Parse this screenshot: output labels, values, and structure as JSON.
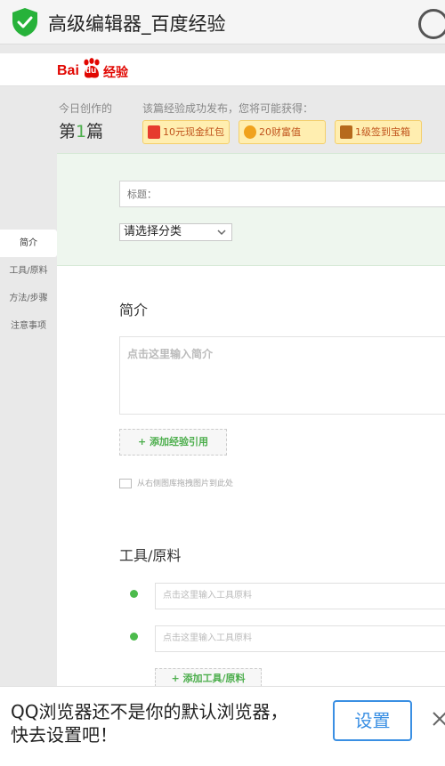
{
  "browser": {
    "title": "高级编辑器_百度经验",
    "shield_icon": "shield-check-icon",
    "reload_icon": "reload-icon"
  },
  "brand": {
    "logo_bai": "Bai",
    "logo_du": "du",
    "logo_suffix": "经验",
    "logo_color": "#e10601"
  },
  "stats": {
    "today_label": "今日创作的",
    "count_prefix": "第",
    "count_value": "1",
    "count_suffix": "篇"
  },
  "rewards": {
    "tip": "该篇经验成功发布，您将可能获得：",
    "items": [
      {
        "label": "10元现金红包",
        "icon": "red-envelope-icon"
      },
      {
        "label": "20财富值",
        "icon": "coin-icon"
      },
      {
        "label": "1级签到宝箱",
        "icon": "treasure-chest-icon"
      }
    ]
  },
  "sidenav": {
    "items": [
      "简介",
      "工具/原料",
      "方法/步骤",
      "注意事项"
    ],
    "active_index": 0
  },
  "form": {
    "title_placeholder": "标题：",
    "category_value": "请选择分类",
    "intro_heading": "简介",
    "intro_placeholder": "点击这里输入简介",
    "add_reference": "+ 添加经验引用",
    "drag_tip": "从右侧图库拖拽图片到此处",
    "tools_heading": "工具/原料",
    "tool_placeholders": [
      "点击这里输入工具原料",
      "点击这里输入工具原料"
    ],
    "add_tool": "+ 添加工具/原料"
  },
  "banner": {
    "line1": "QQ浏览器还不是你的默认浏览器，",
    "line2": "快去设置吧！",
    "button": "设置",
    "accent": "#3a8fe3"
  },
  "colors": {
    "accent_green": "#4cae4c",
    "reward_bg": "#ffeeb0"
  }
}
